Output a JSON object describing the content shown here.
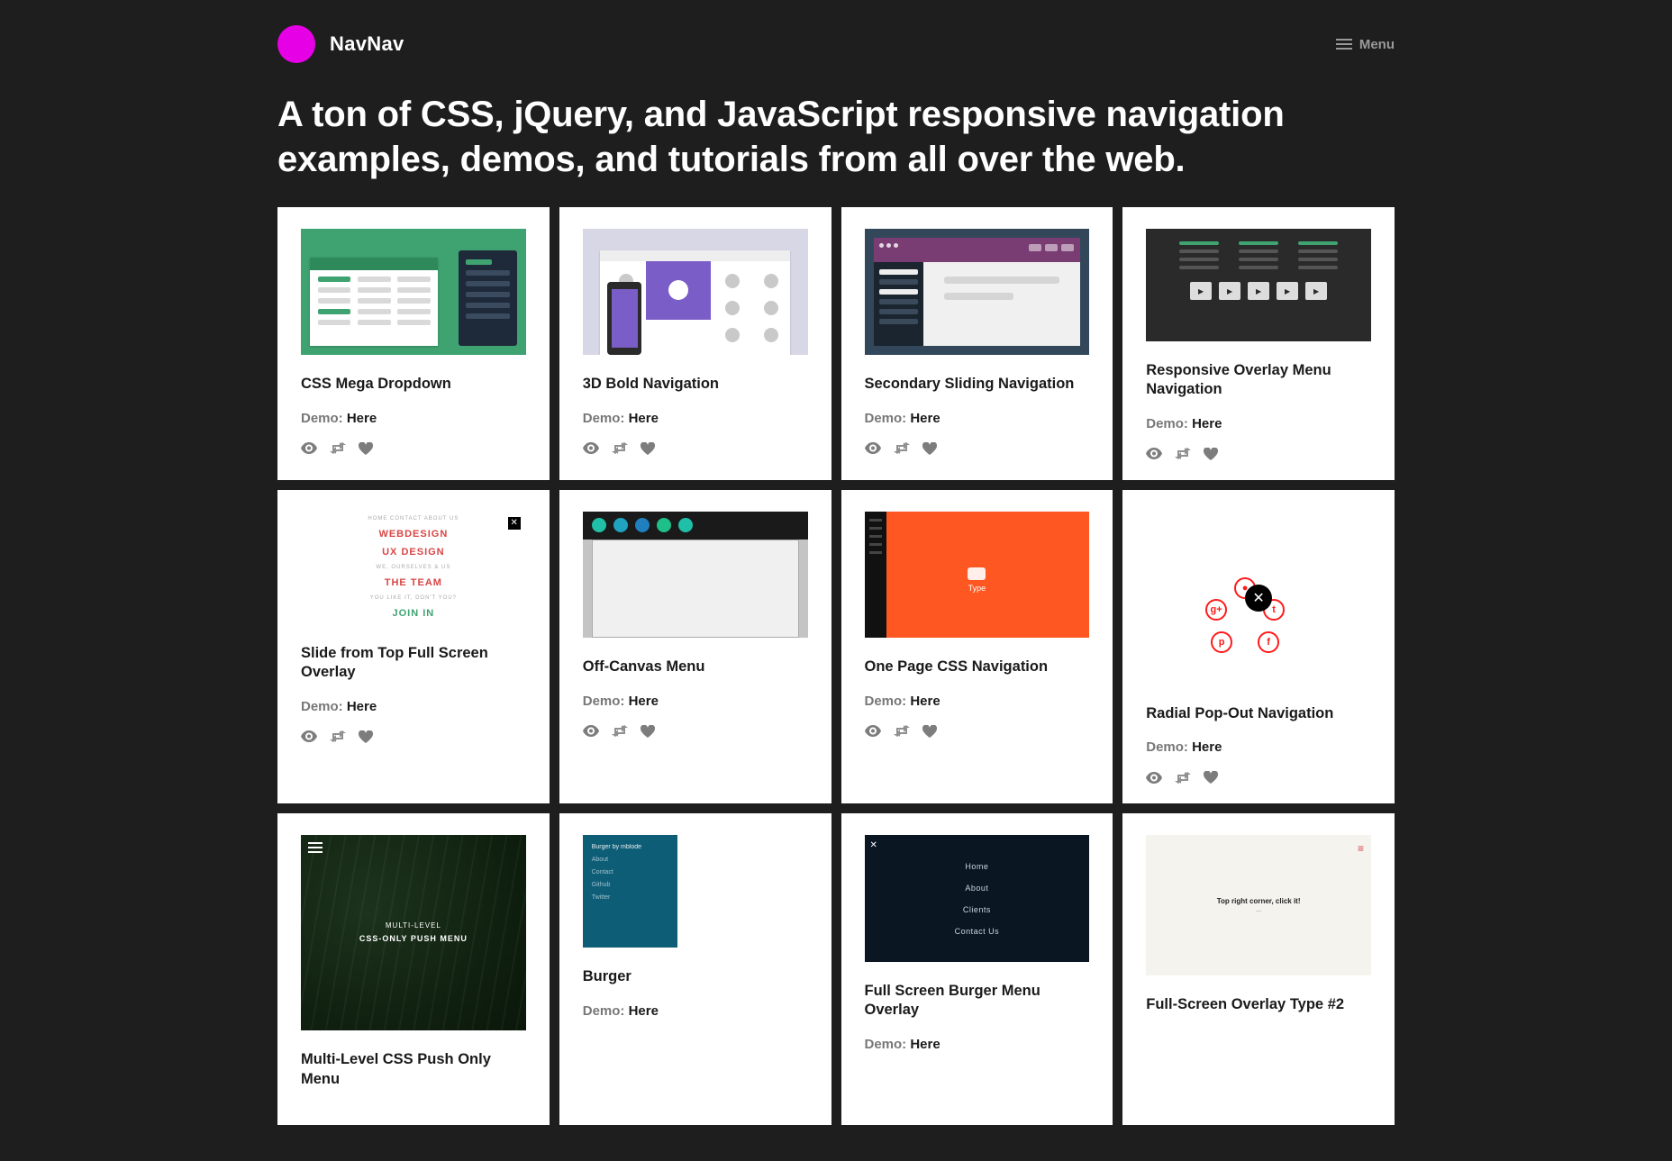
{
  "header": {
    "brand": "NavNav",
    "menu_label": "Menu"
  },
  "tagline": "A ton of CSS, jQuery, and JavaScript responsive navigation examples, demos, and tutorials from all over the web.",
  "demo_prefix": "Demo: ",
  "demo_link": "Here",
  "cards": [
    {
      "title": "CSS Mega Dropdown"
    },
    {
      "title": "3D Bold Navigation"
    },
    {
      "title": "Secondary Sliding Navigation"
    },
    {
      "title": "Responsive Overlay Menu Navigation"
    },
    {
      "title": "Slide from Top Full Screen Overlay"
    },
    {
      "title": "Off-Canvas Menu"
    },
    {
      "title": "One Page CSS Navigation"
    },
    {
      "title": "Radial Pop-Out Navigation"
    },
    {
      "title": "Multi-Level CSS Push Only Menu"
    },
    {
      "title": "Burger"
    },
    {
      "title": "Full Screen Burger Menu Overlay"
    },
    {
      "title": "Full-Screen Overlay Type #2"
    }
  ],
  "thumb4": {
    "a": "HOME   CONTACT   ABOUT US",
    "b": "WEBDESIGN",
    "c": "UX DESIGN",
    "d": "THE TEAM",
    "e": "JOIN IN"
  },
  "thumb6": {
    "label": "Type"
  },
  "thumb8": {
    "a": "MULTI-LEVEL",
    "b": "CSS-ONLY PUSH MENU"
  },
  "thumb9": {
    "h": "Burger by mblode",
    "a": "About",
    "b": "Contact",
    "c": "Github",
    "d": "Twitter"
  },
  "thumb10": {
    "a": "Home",
    "b": "About",
    "c": "Clients",
    "d": "Contact Us"
  },
  "thumb11": {
    "h": "Top right corner, click it!",
    "s": "—"
  }
}
